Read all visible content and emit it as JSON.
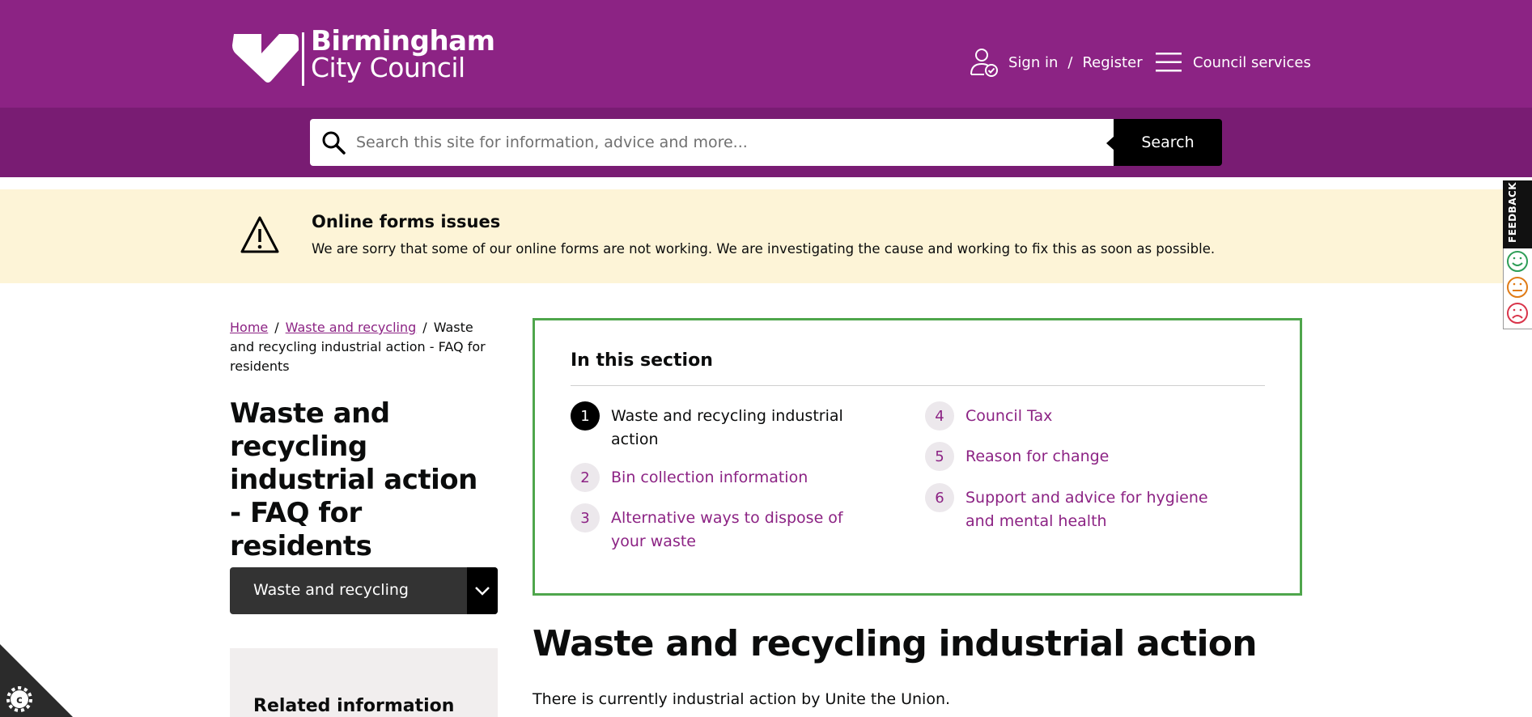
{
  "header": {
    "logo_line1": "Birmingham",
    "logo_line2": "City Council",
    "sign_in": "Sign in",
    "separator": "/",
    "register": "Register",
    "council_services": "Council services"
  },
  "search": {
    "placeholder": "Search this site for information, advice and more...",
    "button_label": "Search"
  },
  "alert": {
    "title": "Online forms issues",
    "text": "We are sorry that some of our online forms are not working. We are investigating the cause and working to fix this as soon as possible."
  },
  "breadcrumb": {
    "home": "Home",
    "parent": "Waste and recycling",
    "current": "Waste and recycling industrial action - FAQ for residents"
  },
  "page_title": "Waste and recycling industrial action - FAQ for residents",
  "dropdown": {
    "label": "Waste and recycling"
  },
  "related": {
    "title": "Related information"
  },
  "section": {
    "heading": "In this section",
    "items": [
      {
        "num": "1",
        "label": "Waste and recycling industrial action",
        "active": true
      },
      {
        "num": "2",
        "label": "Bin collection information",
        "active": false
      },
      {
        "num": "3",
        "label": "Alternative ways to dispose of your waste",
        "active": false
      },
      {
        "num": "4",
        "label": "Council Tax",
        "active": false
      },
      {
        "num": "5",
        "label": "Reason for change",
        "active": false
      },
      {
        "num": "6",
        "label": "Support and advice for hygiene and mental health",
        "active": false
      }
    ]
  },
  "main": {
    "heading": "Waste and recycling industrial action",
    "intro": "There is currently industrial action by Unite the Union."
  },
  "feedback": {
    "label": "FEEDBACK"
  },
  "colors": {
    "brand_purple": "#8c2384",
    "search_band": "#791c73",
    "alert_bg": "#fdf4d7",
    "section_border": "#4fa64c"
  }
}
